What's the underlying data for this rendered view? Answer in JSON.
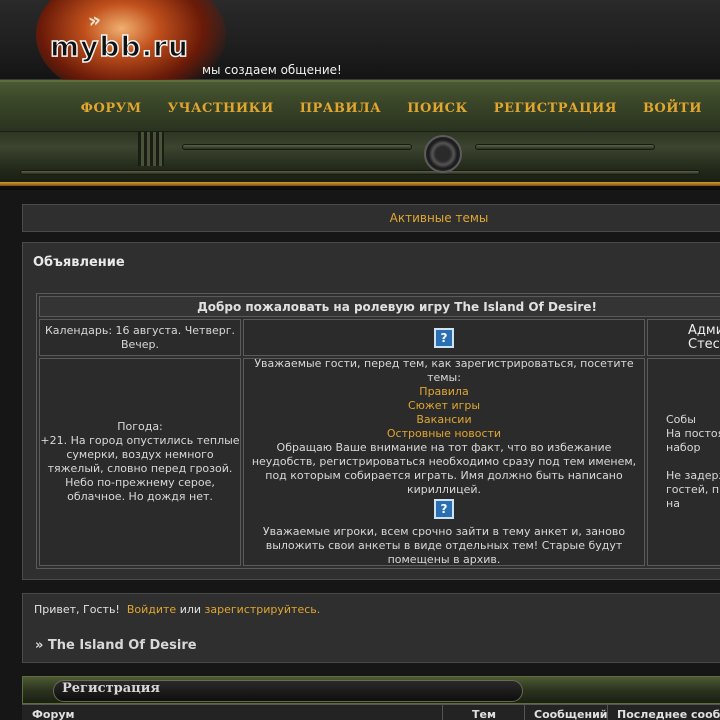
{
  "header": {
    "logo_text": "mybb.ru",
    "slogan": "мы создаем общение!",
    "nav": [
      "ФОРУМ",
      "УЧАСТНИКИ",
      "ПРАВИЛА",
      "ПОИСК",
      "РЕГИСТРАЦИЯ",
      "ВОЙТИ"
    ],
    "accent_color": "#e0a630"
  },
  "active_topics": "Активные темы",
  "announcement": {
    "title": "Объявление",
    "welcome": "Добро пожаловать на ролевую игру The Island Of Desire!",
    "calendar": "Календарь: 16 августа. Четверг. Вечер.",
    "admin_partial_1": "Адми",
    "admin_partial_2": "Стес",
    "weather_label": "Погода:",
    "weather_text": "+21. На город опустились теплые сумерки, воздух немного тяжелый, словно перед грозой. Небо по-прежнему серое, облачное. Но дождя нет.",
    "guests_intro": "Уважаемые гости, перед тем, как зарегистрироваться, посетите темы:",
    "links": [
      "Правила",
      "Сюжет игры",
      "Вакансии",
      "Островные новости"
    ],
    "notice": "Обращаю Ваше внимание на тот факт, что во избежание неудобств, регистрироваться необходимо сразу под тем именем, под которым собирается играть. Имя должно быть написано кириллицей.",
    "players_notice": "Уважаемые игроки, всем срочно зайти в тему анкет и, заново выложить свои анкеты в виде отдельных тем! Старые будут помещены в архив.",
    "right_partial": [
      "Собы",
      "На постоя",
      "набор",
      "",
      "Не задерж",
      "гостей, п",
      "на"
    ]
  },
  "greeting": {
    "prefix": "Привет, Гость!",
    "login": "Войдите",
    "or": "или",
    "register": "зарегистрируйтесь."
  },
  "forum_title": "» The Island Of Desire",
  "category": {
    "label": "Регистрация",
    "columns": [
      "Форум",
      "Тем",
      "Сообщений",
      "Последнее сообщ"
    ]
  }
}
